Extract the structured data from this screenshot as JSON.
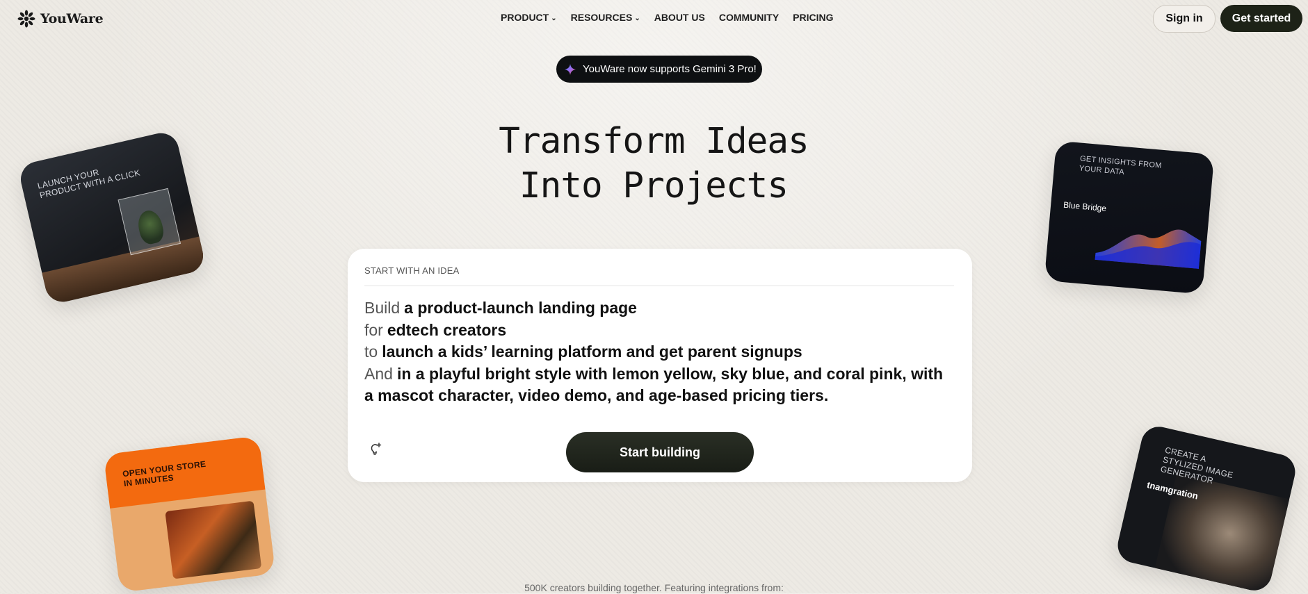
{
  "brand": {
    "name": "YouWare"
  },
  "nav": {
    "items": [
      {
        "label": "PRODUCT",
        "has_dropdown": true
      },
      {
        "label": "RESOURCES",
        "has_dropdown": true
      },
      {
        "label": "ABOUT US",
        "has_dropdown": false
      },
      {
        "label": "COMMUNITY",
        "has_dropdown": false
      },
      {
        "label": "PRICING",
        "has_dropdown": false
      }
    ],
    "signin_label": "Sign in",
    "get_started_label": "Get started"
  },
  "announcement": {
    "text": "YouWare now supports Gemini 3 Pro!"
  },
  "hero": {
    "line1": "Transform Ideas",
    "line2": "Into Projects"
  },
  "idea_card": {
    "label": "START WITH AN IDEA",
    "prompt": [
      {
        "prefix": "Build",
        "text": "a product-launch landing page"
      },
      {
        "prefix": "for",
        "text": "edtech creators"
      },
      {
        "prefix": "to",
        "text": "launch a kids’ learning platform and get parent signups"
      },
      {
        "prefix": "And",
        "text": "in a playful bright style with lemon yellow, sky blue, and coral pink, with a mascot character, video demo, and age-based pricing tiers."
      }
    ],
    "button_label": "Start building"
  },
  "tiles": [
    {
      "title": "LAUNCH YOUR PRODUCT WITH A CLICK"
    },
    {
      "title": "GET INSIGHTS FROM YOUR DATA",
      "subtitle": "Blue Bridge"
    },
    {
      "title": "OPEN YOUR STORE IN MINUTES"
    },
    {
      "title": "CREATE A STYLIZED IMAGE GENERATOR",
      "subtitle": "tnamgration"
    }
  ],
  "creators_text": "500K creators building together. Featuring integrations from:",
  "colors": {
    "background": "#edeae4",
    "dark_button": "#1d2217",
    "accent_orange": "#f36a0f"
  }
}
